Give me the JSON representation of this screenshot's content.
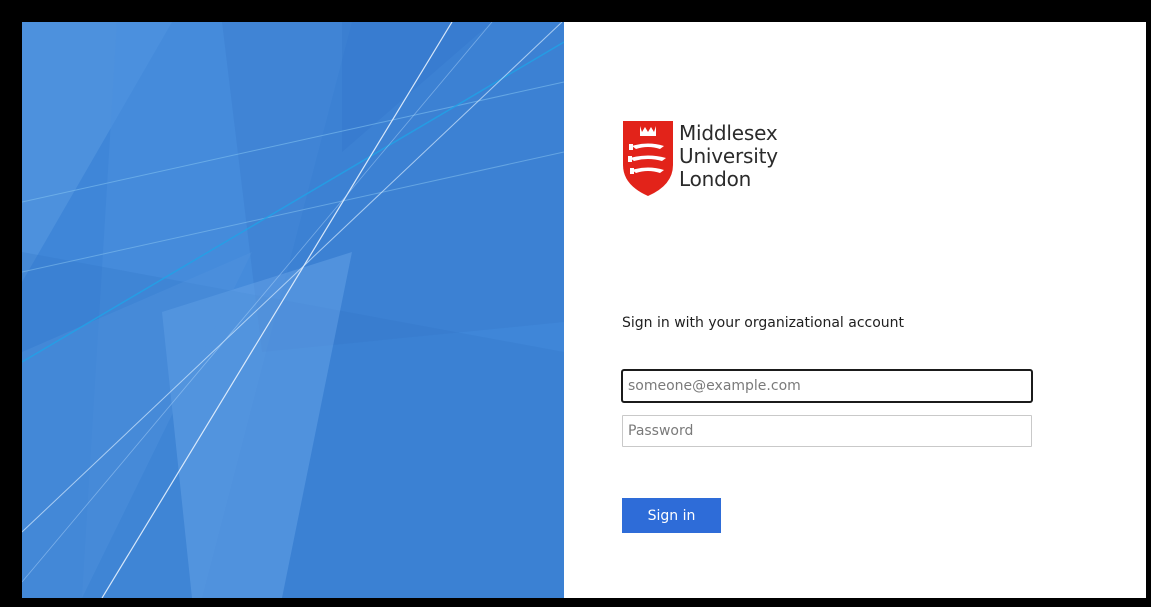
{
  "brand": {
    "name_lines": [
      "Middlesex",
      "University",
      "London"
    ],
    "shield_icon": "middlesex-shield-icon",
    "colors": {
      "shield_red": "#e2231a",
      "text": "#2b2b2b"
    }
  },
  "signin": {
    "prompt": "Sign in with your organizational account",
    "email_placeholder": "someone@example.com",
    "password_placeholder": "Password",
    "button_label": "Sign in"
  },
  "colors": {
    "illustration_blue": "#3f86d8",
    "button_blue": "#2e6cd8",
    "frame": "#000000"
  }
}
